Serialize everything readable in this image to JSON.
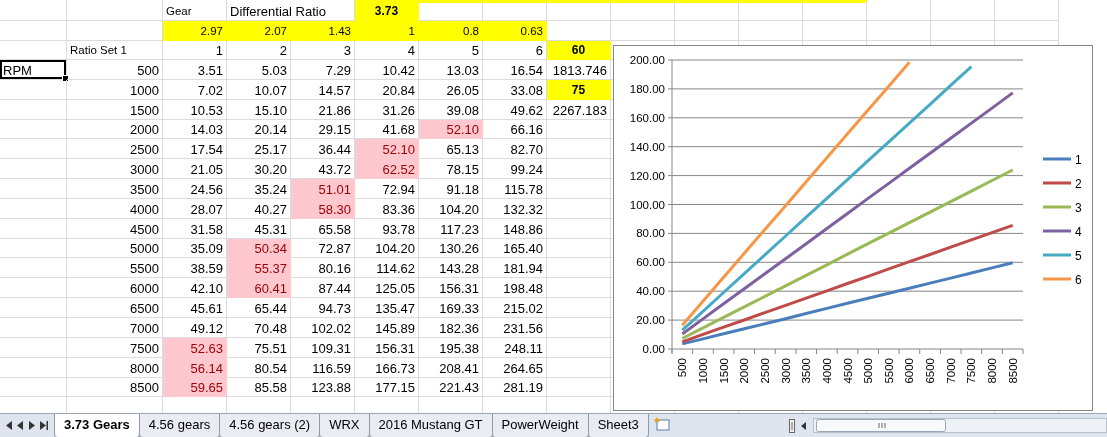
{
  "sheet": {
    "gear_label": "Gear",
    "diff_label": "Differential Ratio",
    "diff_value": "3.73",
    "ratios": [
      "2.97",
      "2.07",
      "1.43",
      "1",
      "0.8",
      "0.63"
    ],
    "set_label": "Ratio Set 1",
    "gears": [
      "1",
      "2",
      "3",
      "4",
      "5",
      "6"
    ],
    "active_cell": {
      "text": "RPM",
      "active": true
    },
    "side": [
      {
        "text": "60",
        "kind": "input"
      },
      {
        "text": "1813.746",
        "kind": "result"
      },
      {
        "text": "75",
        "kind": "input"
      },
      {
        "text": "2267.183",
        "kind": "result"
      }
    ],
    "rows": [
      {
        "rpm": "500",
        "speeds": [
          {
            "text": "3.51",
            "highlighted": false
          },
          {
            "text": "5.03",
            "highlighted": false
          },
          {
            "text": "7.29",
            "highlighted": false
          },
          {
            "text": "10.42",
            "highlighted": false
          },
          {
            "text": "13.03",
            "highlighted": false
          },
          {
            "text": "16.54",
            "highlighted": false
          }
        ]
      },
      {
        "rpm": "1000",
        "speeds": [
          {
            "text": "7.02",
            "highlighted": false
          },
          {
            "text": "10.07",
            "highlighted": false
          },
          {
            "text": "14.57",
            "highlighted": false
          },
          {
            "text": "20.84",
            "highlighted": false
          },
          {
            "text": "26.05",
            "highlighted": false
          },
          {
            "text": "33.08",
            "highlighted": false
          }
        ]
      },
      {
        "rpm": "1500",
        "speeds": [
          {
            "text": "10.53",
            "highlighted": false
          },
          {
            "text": "15.10",
            "highlighted": false
          },
          {
            "text": "21.86",
            "highlighted": false
          },
          {
            "text": "31.26",
            "highlighted": false
          },
          {
            "text": "39.08",
            "highlighted": false
          },
          {
            "text": "49.62",
            "highlighted": false
          }
        ]
      },
      {
        "rpm": "2000",
        "speeds": [
          {
            "text": "14.03",
            "highlighted": false
          },
          {
            "text": "20.14",
            "highlighted": false
          },
          {
            "text": "29.15",
            "highlighted": false
          },
          {
            "text": "41.68",
            "highlighted": false
          },
          {
            "text": "52.10",
            "highlighted": true
          },
          {
            "text": "66.16",
            "highlighted": false
          }
        ]
      },
      {
        "rpm": "2500",
        "speeds": [
          {
            "text": "17.54",
            "highlighted": false
          },
          {
            "text": "25.17",
            "highlighted": false
          },
          {
            "text": "36.44",
            "highlighted": false
          },
          {
            "text": "52.10",
            "highlighted": true
          },
          {
            "text": "65.13",
            "highlighted": false
          },
          {
            "text": "82.70",
            "highlighted": false
          }
        ]
      },
      {
        "rpm": "3000",
        "speeds": [
          {
            "text": "21.05",
            "highlighted": false
          },
          {
            "text": "30.20",
            "highlighted": false
          },
          {
            "text": "43.72",
            "highlighted": false
          },
          {
            "text": "62.52",
            "highlighted": true
          },
          {
            "text": "78.15",
            "highlighted": false
          },
          {
            "text": "99.24",
            "highlighted": false
          }
        ]
      },
      {
        "rpm": "3500",
        "speeds": [
          {
            "text": "24.56",
            "highlighted": false
          },
          {
            "text": "35.24",
            "highlighted": false
          },
          {
            "text": "51.01",
            "highlighted": true
          },
          {
            "text": "72.94",
            "highlighted": false
          },
          {
            "text": "91.18",
            "highlighted": false
          },
          {
            "text": "115.78",
            "highlighted": false
          }
        ]
      },
      {
        "rpm": "4000",
        "speeds": [
          {
            "text": "28.07",
            "highlighted": false
          },
          {
            "text": "40.27",
            "highlighted": false
          },
          {
            "text": "58.30",
            "highlighted": true
          },
          {
            "text": "83.36",
            "highlighted": false
          },
          {
            "text": "104.20",
            "highlighted": false
          },
          {
            "text": "132.32",
            "highlighted": false
          }
        ]
      },
      {
        "rpm": "4500",
        "speeds": [
          {
            "text": "31.58",
            "highlighted": false
          },
          {
            "text": "45.31",
            "highlighted": false
          },
          {
            "text": "65.58",
            "highlighted": false
          },
          {
            "text": "93.78",
            "highlighted": false
          },
          {
            "text": "117.23",
            "highlighted": false
          },
          {
            "text": "148.86",
            "highlighted": false
          }
        ]
      },
      {
        "rpm": "5000",
        "speeds": [
          {
            "text": "35.09",
            "highlighted": false
          },
          {
            "text": "50.34",
            "highlighted": true
          },
          {
            "text": "72.87",
            "highlighted": false
          },
          {
            "text": "104.20",
            "highlighted": false
          },
          {
            "text": "130.26",
            "highlighted": false
          },
          {
            "text": "165.40",
            "highlighted": false
          }
        ]
      },
      {
        "rpm": "5500",
        "speeds": [
          {
            "text": "38.59",
            "highlighted": false
          },
          {
            "text": "55.37",
            "highlighted": true
          },
          {
            "text": "80.16",
            "highlighted": false
          },
          {
            "text": "114.62",
            "highlighted": false
          },
          {
            "text": "143.28",
            "highlighted": false
          },
          {
            "text": "181.94",
            "highlighted": false
          }
        ]
      },
      {
        "rpm": "6000",
        "speeds": [
          {
            "text": "42.10",
            "highlighted": false
          },
          {
            "text": "60.41",
            "highlighted": true
          },
          {
            "text": "87.44",
            "highlighted": false
          },
          {
            "text": "125.05",
            "highlighted": false
          },
          {
            "text": "156.31",
            "highlighted": false
          },
          {
            "text": "198.48",
            "highlighted": false
          }
        ]
      },
      {
        "rpm": "6500",
        "speeds": [
          {
            "text": "45.61",
            "highlighted": false
          },
          {
            "text": "65.44",
            "highlighted": false
          },
          {
            "text": "94.73",
            "highlighted": false
          },
          {
            "text": "135.47",
            "highlighted": false
          },
          {
            "text": "169.33",
            "highlighted": false
          },
          {
            "text": "215.02",
            "highlighted": false
          }
        ]
      },
      {
        "rpm": "7000",
        "speeds": [
          {
            "text": "49.12",
            "highlighted": false
          },
          {
            "text": "70.48",
            "highlighted": false
          },
          {
            "text": "102.02",
            "highlighted": false
          },
          {
            "text": "145.89",
            "highlighted": false
          },
          {
            "text": "182.36",
            "highlighted": false
          },
          {
            "text": "231.56",
            "highlighted": false
          }
        ]
      },
      {
        "rpm": "7500",
        "speeds": [
          {
            "text": "52.63",
            "highlighted": true
          },
          {
            "text": "75.51",
            "highlighted": false
          },
          {
            "text": "109.31",
            "highlighted": false
          },
          {
            "text": "156.31",
            "highlighted": false
          },
          {
            "text": "195.38",
            "highlighted": false
          },
          {
            "text": "248.11",
            "highlighted": false
          }
        ]
      },
      {
        "rpm": "8000",
        "speeds": [
          {
            "text": "56.14",
            "highlighted": true
          },
          {
            "text": "80.54",
            "highlighted": false
          },
          {
            "text": "116.59",
            "highlighted": false
          },
          {
            "text": "166.73",
            "highlighted": false
          },
          {
            "text": "208.41",
            "highlighted": false
          },
          {
            "text": "264.65",
            "highlighted": false
          }
        ]
      },
      {
        "rpm": "8500",
        "speeds": [
          {
            "text": "59.65",
            "highlighted": true
          },
          {
            "text": "85.58",
            "highlighted": false
          },
          {
            "text": "123.88",
            "highlighted": false
          },
          {
            "text": "177.15",
            "highlighted": false
          },
          {
            "text": "221.43",
            "highlighted": false
          },
          {
            "text": "281.19",
            "highlighted": false
          }
        ]
      }
    ],
    "chart_data": {
      "type": "line",
      "categories": [
        "500",
        "1000",
        "1500",
        "2000",
        "2500",
        "3000",
        "3500",
        "4000",
        "4500",
        "5000",
        "5500",
        "6000",
        "6500",
        "7000",
        "7500",
        "8000",
        "8500"
      ],
      "series": [
        {
          "name": "1",
          "color": "#4a7ebb",
          "values": [
            3.5,
            7,
            10.5,
            14,
            17.5,
            21,
            24.6,
            28.1,
            31.6,
            35.1,
            38.6,
            42.1,
            45.6,
            49.1,
            52.6,
            56.1,
            59.7
          ]
        },
        {
          "name": "2",
          "color": "#be4b48",
          "values": [
            5,
            10.1,
            15.1,
            20.1,
            25.2,
            30.2,
            35.2,
            40.3,
            45.3,
            50.3,
            55.4,
            60.4,
            65.4,
            70.5,
            75.5,
            80.5,
            85.6
          ]
        },
        {
          "name": "3",
          "color": "#98b954",
          "values": [
            7.3,
            14.6,
            21.9,
            29.2,
            36.4,
            43.7,
            51,
            58.3,
            65.6,
            72.9,
            80.2,
            87.4,
            94.7,
            102,
            109.3,
            116.6,
            123.9
          ]
        },
        {
          "name": "4",
          "color": "#7d60a0",
          "values": [
            10.4,
            20.8,
            31.3,
            41.7,
            52.1,
            62.5,
            72.9,
            83.4,
            93.8,
            104.2,
            114.6,
            125.1,
            135.5,
            145.9,
            156.3,
            166.7,
            177.2
          ]
        },
        {
          "name": "5",
          "color": "#46aac5",
          "values": [
            13,
            26.1,
            39.1,
            52.1,
            65.1,
            78.2,
            91.2,
            104.2,
            117.2,
            130.3,
            143.3,
            156.3,
            169.3,
            182.4,
            195.4,
            null,
            null
          ]
        },
        {
          "name": "6",
          "color": "#f79646",
          "values": [
            16.5,
            33.1,
            49.6,
            66.2,
            82.7,
            99.2,
            115.8,
            132.3,
            148.9,
            165.4,
            181.9,
            198.5,
            null,
            null,
            null,
            null,
            null
          ]
        }
      ],
      "grid": true,
      "legend": true,
      "ylim": [
        0,
        200
      ],
      "yticks": [
        {
          "value": 0,
          "label": "0.00"
        },
        {
          "value": 20,
          "label": "20.00"
        },
        {
          "value": 40,
          "label": "40.00"
        },
        {
          "value": 60,
          "label": "60.00"
        },
        {
          "value": 80,
          "label": "80.00"
        },
        {
          "value": 100,
          "label": "100.00"
        },
        {
          "value": 120,
          "label": "120.00"
        },
        {
          "value": 140,
          "label": "140.00"
        },
        {
          "value": 160,
          "label": "160.00"
        },
        {
          "value": 180,
          "label": "180.00"
        },
        {
          "value": 200,
          "label": "200.00"
        }
      ]
    }
  },
  "sheet_tabs": [
    {
      "label": "3.73 Gears",
      "selected": true
    },
    {
      "label": "4.56 gears",
      "selected": false
    },
    {
      "label": "4.56 gears (2)",
      "selected": false
    },
    {
      "label": "WRX",
      "selected": false
    },
    {
      "label": "2016 Mustang GT",
      "selected": false
    },
    {
      "label": "PowerWeight",
      "selected": false
    },
    {
      "label": "Sheet3",
      "selected": false
    }
  ]
}
